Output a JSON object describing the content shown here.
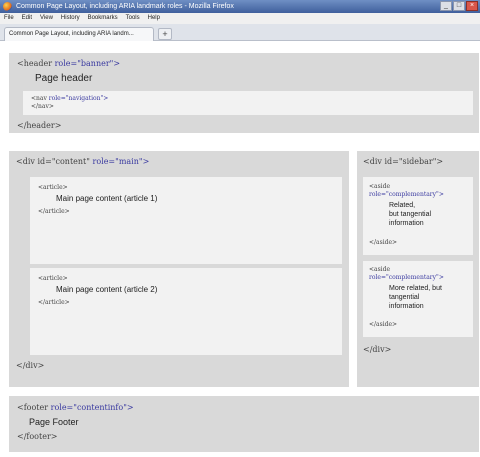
{
  "window": {
    "title": "Common Page Layout, including ARIA landmark roles - Mozilla Firefox",
    "controls": {
      "minimize": "_",
      "maximize": "□",
      "close": "×"
    }
  },
  "menu": [
    "File",
    "Edit",
    "View",
    "History",
    "Bookmarks",
    "Tools",
    "Help"
  ],
  "tab": {
    "label": "Common Page Layout, including ARIA landm...",
    "new_tab": "+"
  },
  "header": {
    "open_tag": "<header",
    "role": "role=\"banner\">",
    "text": "Page header",
    "nav": {
      "open_tag": "<nav",
      "role": "role=\"navigation\">",
      "close_tag": "</nav>"
    },
    "close_tag": "</header>"
  },
  "content": {
    "open_tag": "<div id=\"content\"",
    "role": "role=\"main\">",
    "articles": [
      {
        "open_tag": "<article>",
        "text": "Main page content (article 1)",
        "close_tag": "</article>"
      },
      {
        "open_tag": "<article>",
        "text": "Main page content (article 2)",
        "close_tag": "</article>"
      }
    ],
    "close_tag": "</div>"
  },
  "sidebar": {
    "open_tag": "<div id=\"sidebar\">",
    "asides": [
      {
        "open_tag": "<aside",
        "role": "role=\"complementary\">",
        "lines": [
          "Related,",
          "but tangential",
          "information"
        ],
        "close_tag": "</aside>"
      },
      {
        "open_tag": "<aside",
        "role": "role=\"complementary\">",
        "lines": [
          "More related, but",
          "tangential",
          "information"
        ],
        "close_tag": "</aside>"
      }
    ],
    "close_tag": "</div>"
  },
  "footer": {
    "open_tag": "<footer",
    "role": "role=\"contentinfo\">",
    "text": "Page Footer",
    "close_tag": "</footer>"
  }
}
